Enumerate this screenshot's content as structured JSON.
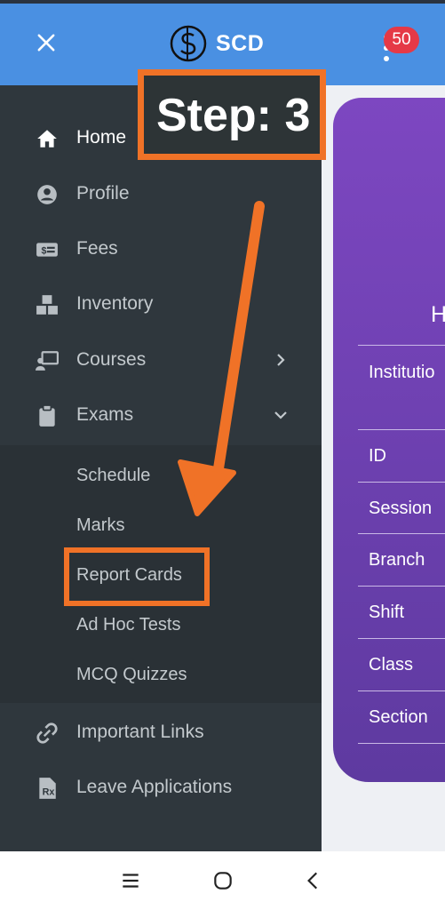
{
  "app": {
    "brand": "SCD",
    "notification_count": "50"
  },
  "sidebar": {
    "items": [
      {
        "label": "Home",
        "icon": "home-icon"
      },
      {
        "label": "Profile",
        "icon": "user-circle-icon"
      },
      {
        "label": "Fees",
        "icon": "money-bill-icon"
      },
      {
        "label": "Inventory",
        "icon": "boxes-icon"
      },
      {
        "label": "Courses",
        "icon": "chalkboard-teacher-icon"
      },
      {
        "label": "Exams",
        "icon": "clipboard-icon"
      },
      {
        "label": "Important Links",
        "icon": "link-icon"
      },
      {
        "label": "Leave Applications",
        "icon": "prescription-icon"
      }
    ],
    "exams_submenu": [
      "Schedule",
      "Marks",
      "Report Cards",
      "Ad Hoc Tests",
      "MCQ Quizzes"
    ]
  },
  "content": {
    "heading_fragment": "H",
    "rows": [
      "Institutio",
      "ID",
      "Session",
      "Branch",
      "Shift",
      "Class",
      "Section"
    ]
  },
  "annotation": {
    "step_text": "Step: 3"
  },
  "colors": {
    "appbar": "#4a90e2",
    "sidebar": "#2f373d",
    "accent": "#f07227",
    "badge": "#e53946",
    "card": "#6a3fb0"
  }
}
